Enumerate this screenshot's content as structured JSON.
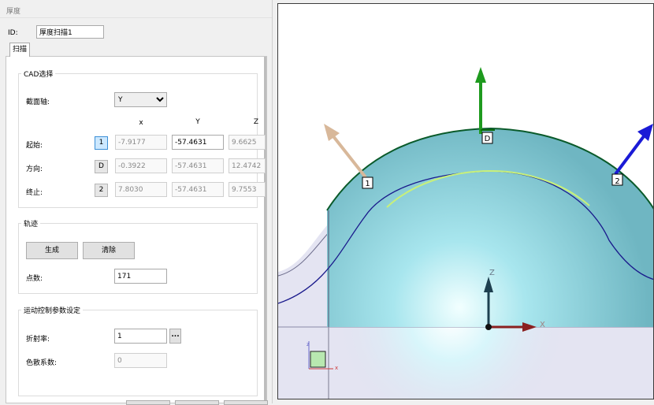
{
  "dialog": {
    "title": "厚度",
    "id_label": "ID:",
    "id_value": "厚度扫描1",
    "tab": "扫描"
  },
  "cad_selection": {
    "title": "CAD选择",
    "axis_label": "截面轴:",
    "axis_value": "Y",
    "axis_options": [
      "Y"
    ],
    "col_x": "x",
    "col_y": "Y",
    "col_z": "Z",
    "rows": [
      {
        "label": "起始:",
        "badge": "1",
        "x": "-7.9177",
        "y": "-57.4631",
        "z": "9.6625"
      },
      {
        "label": "方向:",
        "badge": "D",
        "x": "-0.3922",
        "y": "-57.4631",
        "z": "12.4742"
      },
      {
        "label": "终止:",
        "badge": "2",
        "x": "7.8030",
        "y": "-57.4631",
        "z": "9.7553"
      }
    ]
  },
  "trajectory": {
    "title": "轨迹",
    "generate_label": "生成",
    "clear_label": "清除",
    "points_label": "点数:",
    "points_value": "171"
  },
  "motion": {
    "title": "运动控制参数设定",
    "refraction_label": "折射率:",
    "refraction_value": "1",
    "browse_label": "...",
    "dispersion_label": "色散系数:",
    "dispersion_value": "0"
  },
  "viewport": {
    "markers": {
      "start": "1",
      "dir": "D",
      "end": "2"
    },
    "axes": {
      "x": "X",
      "z": "Z"
    },
    "mini_axes": {
      "x": "x",
      "z": "z"
    },
    "colors": {
      "green_arrow": "#1e9a1e",
      "blue_arrow": "#1a1ad6",
      "tan_arrow": "#d8b89a",
      "dome_fill": "#9fd6de",
      "dome_edge": "#0a7a0a",
      "highlight": "#c8f07a",
      "body": "#e4e4f2"
    }
  }
}
